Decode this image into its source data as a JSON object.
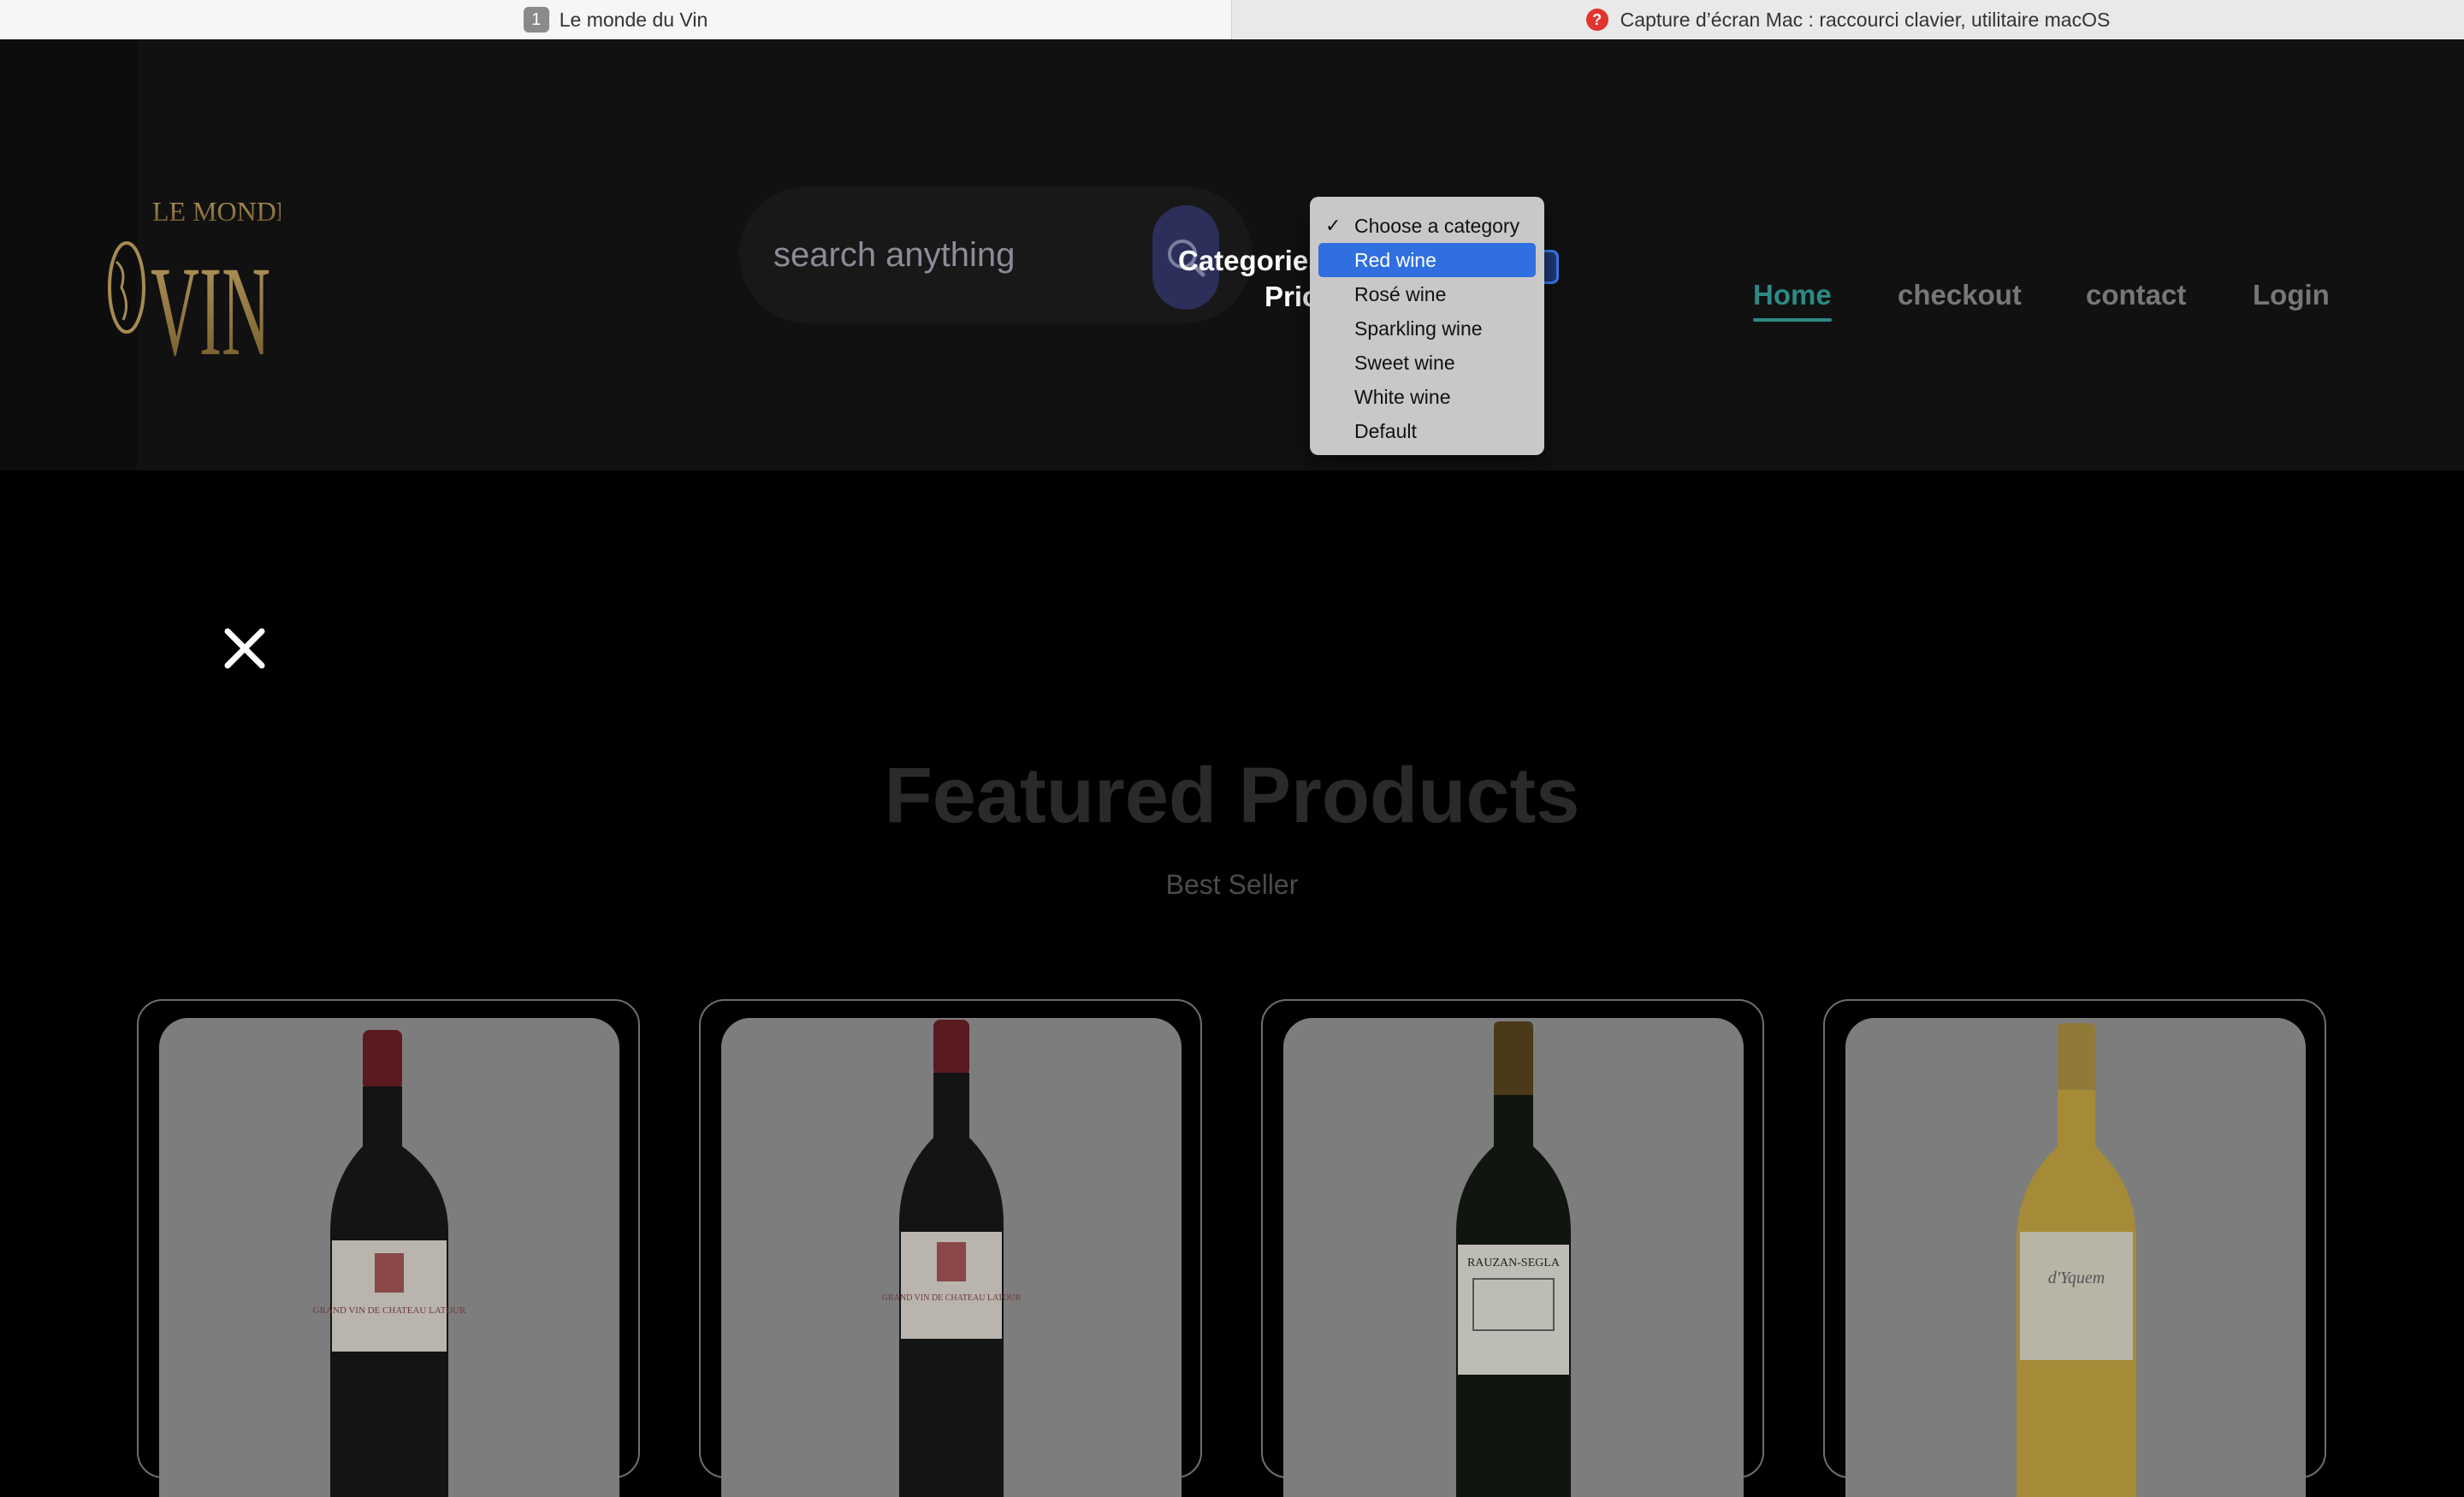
{
  "browser": {
    "tabs": [
      {
        "number": "1",
        "title": "Le monde du Vin"
      },
      {
        "title": "Capture d’écran Mac : raccourci clavier, utilitaire macOS"
      }
    ]
  },
  "header": {
    "logo_text": {
      "top": "LE MONDE DU",
      "main": "VIN"
    },
    "search": {
      "placeholder": "search anything"
    },
    "filters": {
      "categories_label": "Categories",
      "price_label": "Pric"
    },
    "category_select": {
      "options": [
        "Choose a category",
        "Red wine",
        "Rosé wine",
        "Sparkling wine",
        "Sweet wine",
        "White wine",
        "Default"
      ],
      "checked": "Choose a category",
      "highlighted": "Red wine"
    },
    "nav": {
      "home": "Home",
      "checkout": "checkout",
      "contact": "contact",
      "login": "Login"
    }
  },
  "main": {
    "title": "Featured Products",
    "subtitle": "Best Seller",
    "products": [
      {
        "label": "GRAND VIN DE CHATEAU LATOUR",
        "bottle": "red"
      },
      {
        "label": "GRAND VIN DE CHATEAU LATOUR",
        "bottle": "red"
      },
      {
        "label": "CHATEAU RAUZAN-SEGLA",
        "bottle": "red"
      },
      {
        "label": "Château d'Yquem",
        "bottle": "white"
      }
    ]
  },
  "colors": {
    "accent": "#2d8a83",
    "dropdown_selected": "#2f6fe0",
    "background": "#000000"
  }
}
